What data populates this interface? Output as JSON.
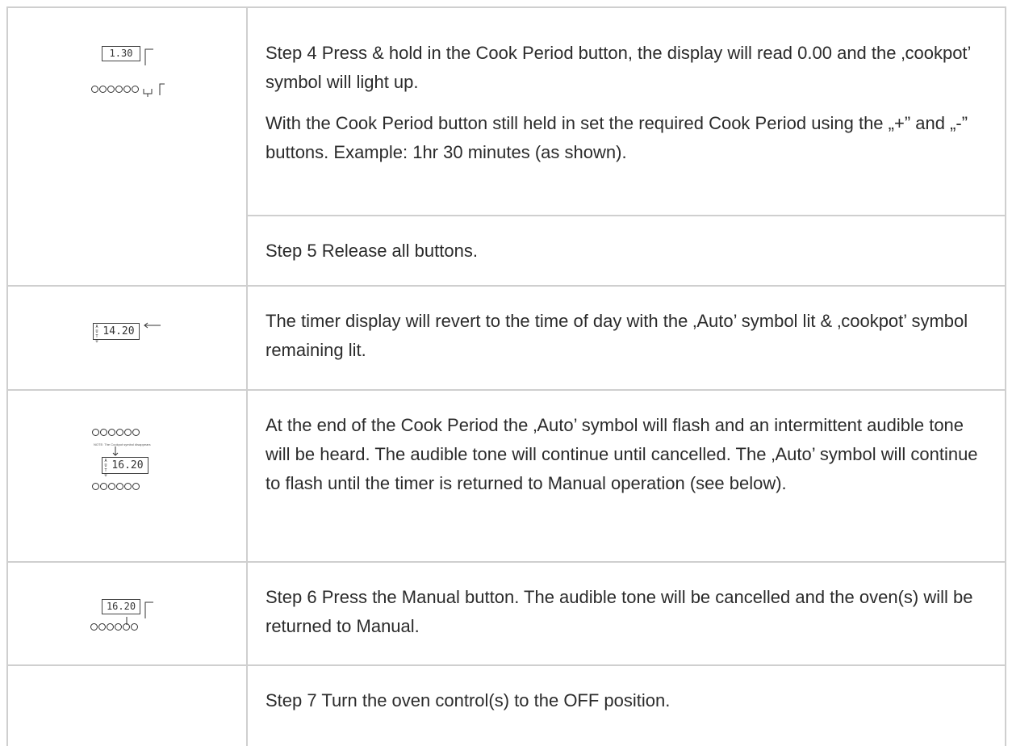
{
  "rows": [
    {
      "paragraphs": [
        "Step 4 Press & hold in the Cook Period button, the display will read 0.00 and the ‚cookpot’ symbol will light up.",
        "With the Cook Period button still held in set the required Cook Period using the „+” and „-” buttons. Example: 1hr 30 minutes (as shown)."
      ],
      "lcd": "1.30"
    },
    {
      "paragraphs": [
        "Step 5 Release all buttons."
      ]
    },
    {
      "paragraphs": [
        "The timer display will revert to the time of day with the ‚Auto’ symbol lit & ‚cookpot’ symbol remaining lit."
      ],
      "lcd": "14.20",
      "lcd_side": "AUTO"
    },
    {
      "paragraphs": [
        "At the end of the Cook Period the ‚Auto’ symbol will flash and an intermittent audible tone will be heard. The audible tone will continue until cancelled. The ‚Auto’ symbol will continue to flash until the timer is returned to Manual operation (see below)."
      ],
      "lcd": "16.20",
      "lcd_side": "AUTO",
      "note": "NOTE: The Cookpot symbol disappears"
    },
    {
      "paragraphs": [
        "Step 6 Press the Manual button. The audible tone will be cancelled and the oven(s) will be returned to Manual."
      ],
      "lcd": "16.20"
    },
    {
      "paragraphs": [
        "Step 7 Turn the oven control(s) to the OFF position."
      ]
    }
  ]
}
